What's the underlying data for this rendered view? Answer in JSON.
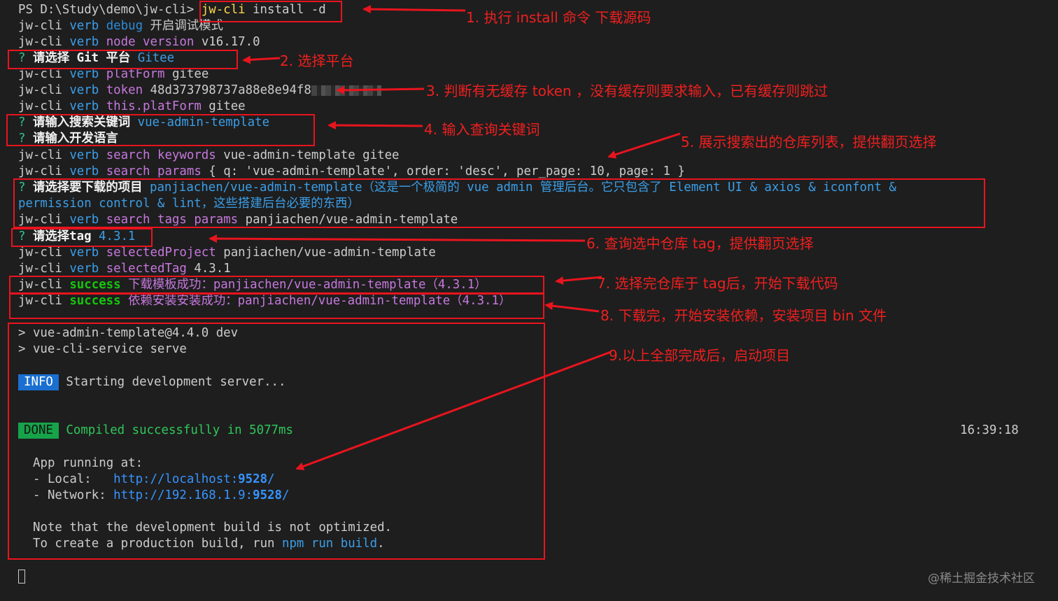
{
  "prompt": "PS D:\\Study\\demo\\jw-cli>",
  "command": "jw-cli",
  "command_args": " install -d",
  "lines": {
    "l2": {
      "a": "jw-cli",
      "b": "verb",
      "c": "debug",
      "d": "开启调试模式"
    },
    "l3": {
      "a": "jw-cli",
      "b": "verb",
      "c": "node version",
      "d": "v16.17.0"
    },
    "l4": {
      "q": "?",
      "label": "请选择 Git 平台",
      "value": "Gitee"
    },
    "l5": {
      "a": "jw-cli",
      "b": "verb",
      "c": "platForm",
      "d": "gitee"
    },
    "l6": {
      "a": "jw-cli",
      "b": "verb",
      "c": "token",
      "d": "48d373798737a88e8e94f8"
    },
    "l7": {
      "a": "jw-cli",
      "b": "verb",
      "c": "this.platForm",
      "d": "gitee"
    },
    "l8": {
      "q": "?",
      "label": "请输入搜索关键词",
      "value": "vue-admin-template"
    },
    "l9": {
      "q": "?",
      "label": "请输入开发语言"
    },
    "l10": {
      "a": "jw-cli",
      "b": "verb",
      "c": "search keywords",
      "d": "vue-admin-template gitee"
    },
    "l11": {
      "a": "jw-cli",
      "b": "verb",
      "c": "search params",
      "d": "{ q: 'vue-admin-template', order: 'desc', per_page: 10, page: 1 }"
    },
    "l12": {
      "q": "?",
      "label": "请选择要下载的项目",
      "value": "panjiachen/vue-admin-template（这是一个极简的 vue admin 管理后台。它只包含了 Element UI & axios & iconfont &"
    },
    "l13": {
      "value": "permission control & lint，这些搭建后台必要的东西）"
    },
    "l14": {
      "a": "jw-cli",
      "b": "verb",
      "c": "search tags params",
      "d": "panjiachen/vue-admin-template"
    },
    "l15": {
      "q": "?",
      "label": "请选择tag",
      "value": "4.3.1"
    },
    "l16": {
      "a": "jw-cli",
      "b": "verb",
      "c": "selectedProject",
      "d": "panjiachen/vue-admin-template"
    },
    "l17": {
      "a": "jw-cli",
      "b": "verb",
      "c": "selectedTag",
      "d": "4.3.1"
    },
    "l18": {
      "a": "jw-cli",
      "b": "success",
      "c": "下载模板成功：panjiachen/vue-admin-template（4.3.1）"
    },
    "l19": {
      "a": "jw-cli",
      "b": "success",
      "c": "依赖安装安装成功：panjiachen/vue-admin-template（4.3.1）"
    },
    "l20": "> vue-admin-template@4.4.0 dev",
    "l21": "> vue-cli-service serve",
    "info_badge": "INFO",
    "info_text": "Starting development server...",
    "done_badge": "DONE",
    "done_text": "Compiled successfully in 5077ms",
    "timestamp": "16:39:18",
    "app_running": "App running at:",
    "local_label": "- Local:   ",
    "local_url_a": "http://localhost:",
    "local_url_b": "9528",
    "local_url_c": "/",
    "network_label": "- Network: ",
    "network_url_a": "http://192.168.1.9:",
    "network_url_b": "9528",
    "network_url_c": "/",
    "note1": "Note that the development build is not optimized.",
    "note2_a": "To create a production build, run ",
    "note2_b": "npm run build",
    "note2_c": "."
  },
  "annotations": {
    "a1": "1. 执行 install 命令 下载源码",
    "a2": "2. 选择平台",
    "a3": "3. 判断有无缓存 token ，没有缓存则要求输入，已有缓存则跳过",
    "a4": "4. 输入查询关键词",
    "a5": "5. 展示搜索出的仓库列表，提供翻页选择",
    "a6": "6. 查询选中仓库 tag，提供翻页选择",
    "a7": "7. 选择完仓库于 tag后，开始下载代码",
    "a8": "8. 下载完，开始安装依赖，安装项目 bin 文件",
    "a9": "9.以上全部完成后，启动项目"
  },
  "watermark": "@稀土掘金技术社区",
  "colors": {
    "background": "#1e1e1e",
    "annotation_red": "#e8141e",
    "success_green": "#16c60c",
    "verb_blue": "#3b9ee8",
    "info_badge": "#1a6fd0",
    "done_badge": "#16a34a"
  }
}
